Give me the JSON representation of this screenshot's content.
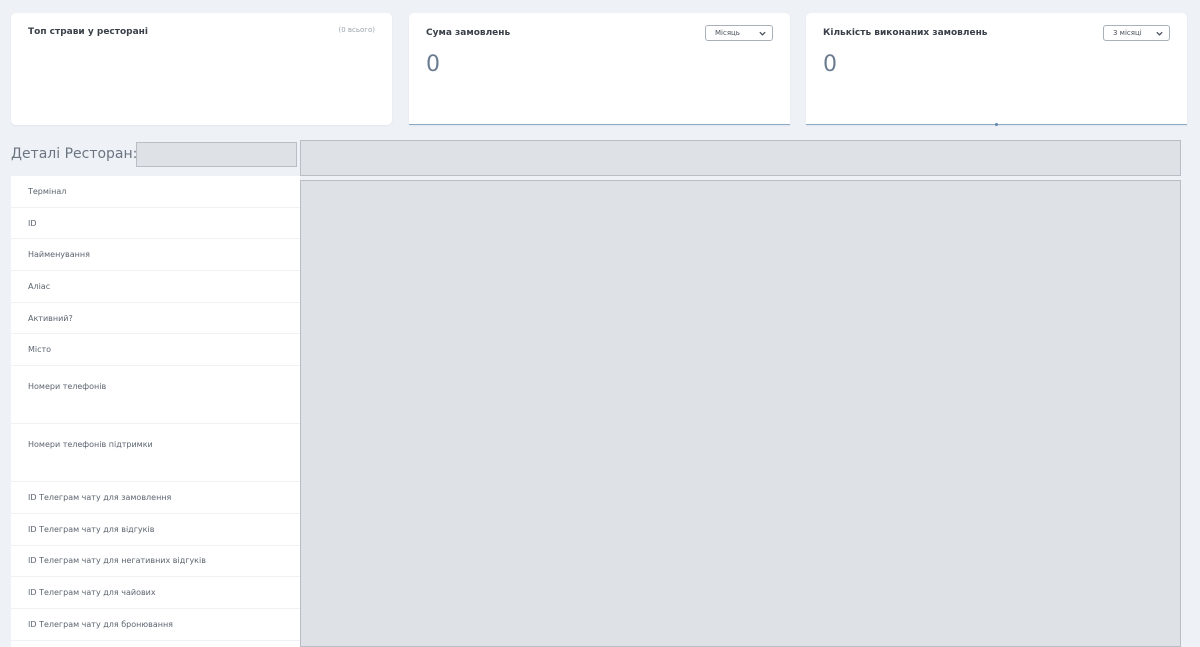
{
  "cards": {
    "top_dishes": {
      "title": "Топ страви у ресторані",
      "meta": "(0 всього)"
    },
    "order_sum": {
      "title": "Сума замовлень",
      "period": "Місяць",
      "value": "0"
    },
    "completed_orders": {
      "title": "Кількість виконаних замовлень",
      "period": "3 місяці",
      "value": "0"
    }
  },
  "details": {
    "title": "Деталі Ресторан: Е",
    "rows": [
      {
        "label": "Термінал"
      },
      {
        "label": "ID"
      },
      {
        "label": "Найменування"
      },
      {
        "label": "Аліас"
      },
      {
        "label": "Активний?"
      },
      {
        "label": "Місто"
      },
      {
        "label": "Номери телефонів"
      },
      {
        "label": "Номери телефонів підтримки"
      },
      {
        "label": "ID Телеграм чату для замовлення"
      },
      {
        "label": "ID Телеграм чату для відгуків"
      },
      {
        "label": "ID Телеграм чату для негативних відгуків"
      },
      {
        "label": "ID Телеграм чату для чайових"
      },
      {
        "label": "ID Телеграм чату для бронювання"
      }
    ]
  },
  "colors": {
    "background": "#eef2f7",
    "card": "#ffffff",
    "masked": "#dee1e6",
    "accent_line": "#8da9c4",
    "value_text": "#6b7c90"
  },
  "icons": {
    "dropdown": "chevron-down-icon"
  }
}
